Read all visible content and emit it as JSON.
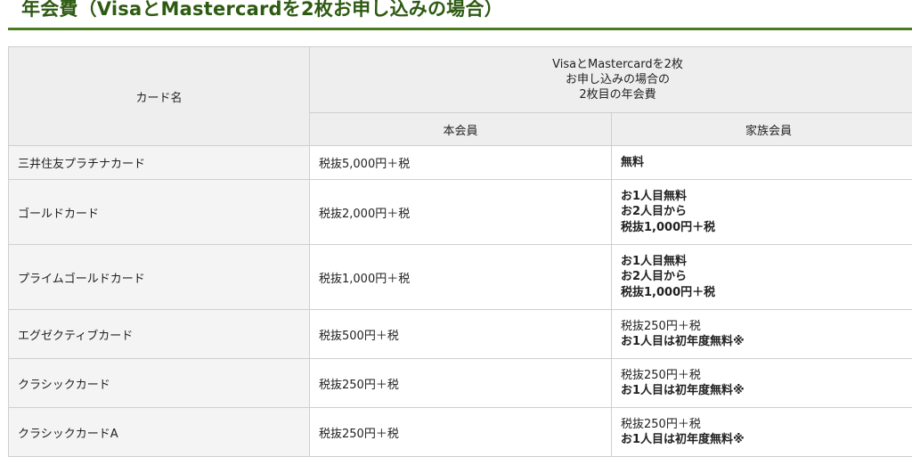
{
  "title": "年会費（VisaとMastercardを2枚お申し込みの場合）",
  "table": {
    "col_card_name": "カード名",
    "group_header": [
      "VisaとMastercardを2枚",
      "お申し込みの場合の",
      "2枚目の年会費"
    ],
    "col_member": "本会員",
    "col_family": "家族会員",
    "rows": [
      {
        "name": "三井住友プラチナカード",
        "member": "税抜5,000円＋税",
        "family": [
          "無料"
        ]
      },
      {
        "name": "ゴールドカード",
        "member": "税抜2,000円＋税",
        "family": [
          "お1人目無料",
          "お2人目から",
          "税抜1,000円＋税"
        ]
      },
      {
        "name": "プライムゴールドカード",
        "member": "税抜1,000円＋税",
        "family": [
          "お1人目無料",
          "お2人目から",
          "税抜1,000円＋税"
        ]
      },
      {
        "name": "エグゼクティブカード",
        "member": "税抜500円＋税",
        "family": [
          "税抜250円＋税",
          "お1人目は初年度無料※"
        ]
      },
      {
        "name": "クラシックカード",
        "member": "税抜250円＋税",
        "family": [
          "税抜250円＋税",
          "お1人目は初年度無料※"
        ]
      },
      {
        "name": "クラシックカードA",
        "member": "税抜250円＋税",
        "family": [
          "税抜250円＋税",
          "お1人目は初年度無料※"
        ]
      }
    ]
  }
}
